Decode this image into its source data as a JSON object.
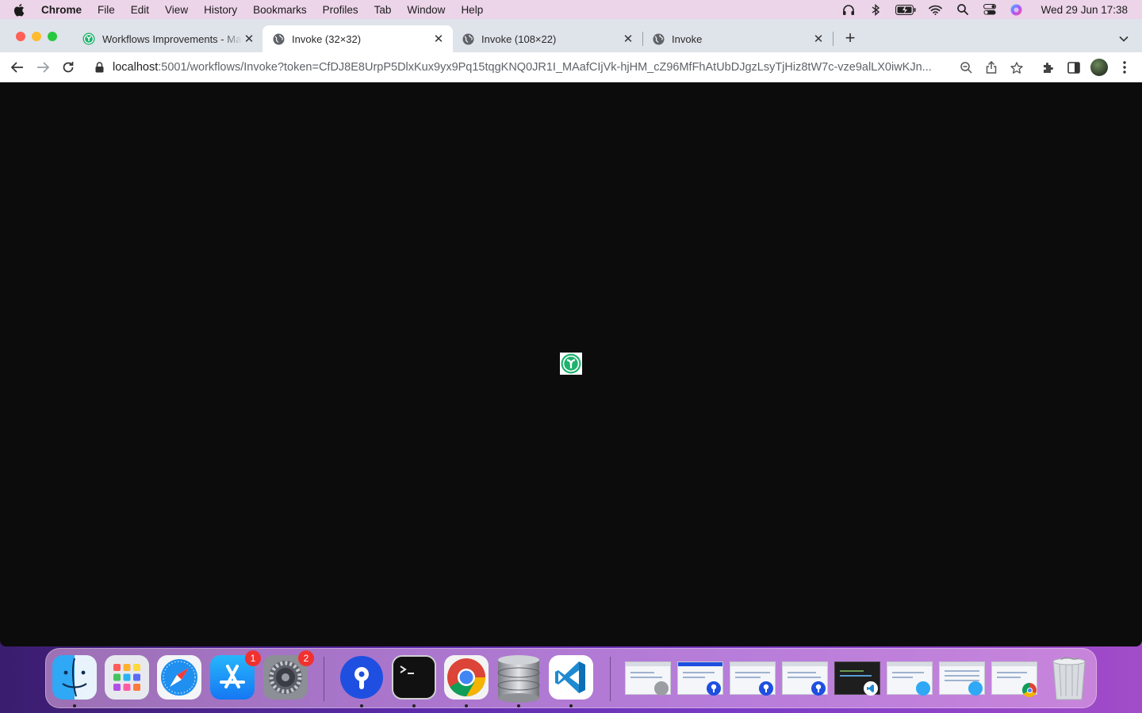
{
  "menubar": {
    "app_name": "Chrome",
    "items": [
      "File",
      "Edit",
      "View",
      "History",
      "Bookmarks",
      "Profiles",
      "Tab",
      "Window",
      "Help"
    ],
    "clock": "Wed 29 Jun  17:38"
  },
  "tabs": [
    {
      "title": "Workflows Improvements - Ma",
      "favicon": "invoke-logo-icon",
      "active": false
    },
    {
      "title": "Invoke (32×32)",
      "favicon": "globe-icon",
      "active": true
    },
    {
      "title": "Invoke (108×22)",
      "favicon": "globe-icon",
      "active": false
    },
    {
      "title": "Invoke",
      "favicon": "globe-icon",
      "active": false
    }
  ],
  "address": {
    "host": "localhost",
    "rest": ":5001/workflows/Invoke?token=CfDJ8E8UrpP5DlxKux9yx9Pq15tqgKNQ0JR1I_MAafCIjVk-hjHM_cZ96MfFhAtUbDJgzLsyTjHiz8tW7c-vze9alLX0iwKJn..."
  },
  "dock": {
    "apps": [
      {
        "name": "finder",
        "running": true
      },
      {
        "name": "launchpad",
        "running": false
      },
      {
        "name": "safari",
        "running": false
      },
      {
        "name": "app-store",
        "running": false,
        "badge": "1"
      },
      {
        "name": "system-preferences",
        "running": false,
        "badge": "2"
      },
      {
        "name": "pin-app",
        "running": true
      },
      {
        "name": "terminal",
        "running": true
      },
      {
        "name": "chrome",
        "running": true
      },
      {
        "name": "database",
        "running": true
      },
      {
        "name": "vscode",
        "running": true
      }
    ]
  },
  "colors": {
    "menubar_bg": "#ecd4e9",
    "tabstrip_bg": "#dfe3ea",
    "content_bg": "#0c0c0c",
    "invoke_green": "#1fb16e"
  }
}
